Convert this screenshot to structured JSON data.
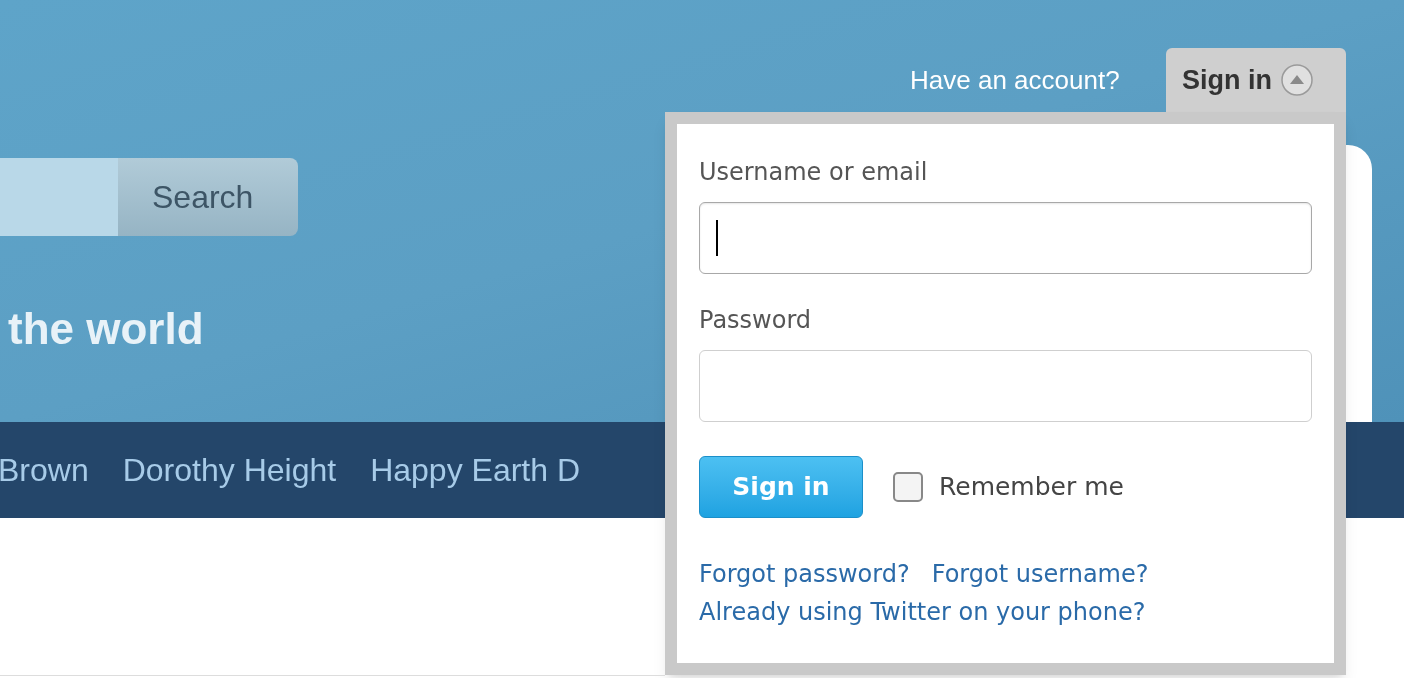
{
  "search": {
    "button": "Search"
  },
  "headline": "the world",
  "nav": {
    "items": [
      "Brown",
      "Dorothy Height",
      "Happy Earth D"
    ]
  },
  "account": {
    "prompt": "Have an account?",
    "signin_tab": {
      "label": "Sign in",
      "expanded": true
    }
  },
  "signin_form": {
    "username_label": "Username or email",
    "username": {
      "focused": true
    },
    "password_label": "Password",
    "submit": "Sign in",
    "remember": {
      "label": "Remember me",
      "checked": false
    },
    "links": [
      {
        "text": "Forgot password?"
      },
      {
        "text": "Forgot username?"
      },
      {
        "text": "Already using Twitter on your phone?"
      }
    ]
  }
}
